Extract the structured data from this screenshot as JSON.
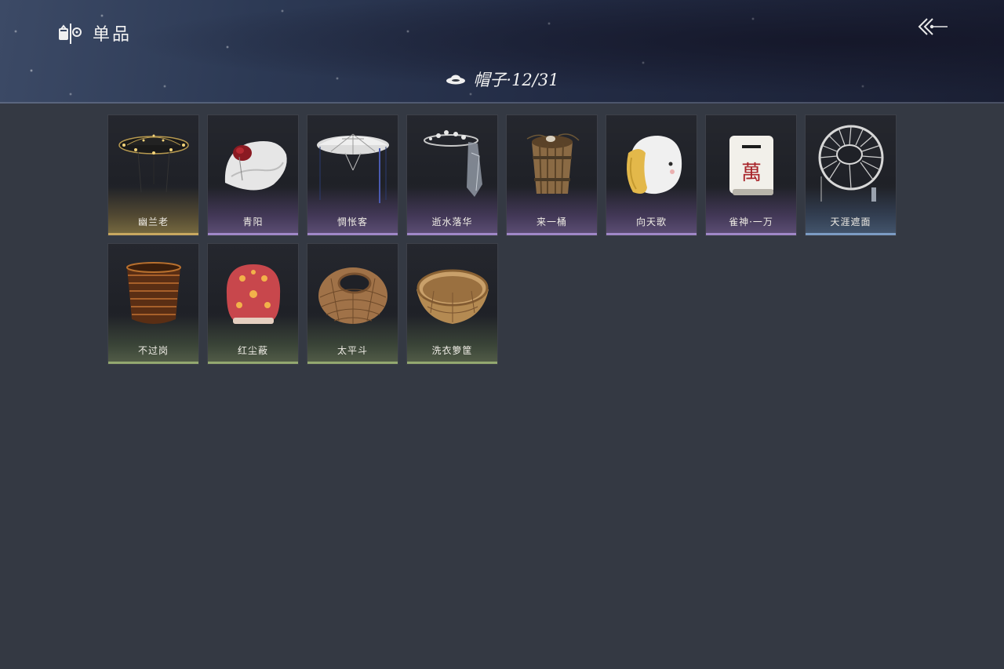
{
  "header": {
    "title": "单品",
    "category_label": "帽子·12/31"
  },
  "items": [
    {
      "name": "幽兰老",
      "rarity": "gold",
      "icon": "black-rain-hat-with-beads"
    },
    {
      "name": "青阳",
      "rarity": "purple",
      "icon": "white-cap-red-flower"
    },
    {
      "name": "惆怅客",
      "rarity": "purple",
      "icon": "white-conical-hat-veil"
    },
    {
      "name": "逝水落华",
      "rarity": "purple",
      "icon": "silver-headpiece-scarf"
    },
    {
      "name": "来一桶",
      "rarity": "purple",
      "icon": "wooden-bucket"
    },
    {
      "name": "向天歌",
      "rarity": "purple",
      "icon": "goose-head-hat"
    },
    {
      "name": "雀神·一万",
      "rarity": "purple",
      "icon": "mahjong-tile"
    },
    {
      "name": "天涯遮面",
      "rarity": "blue",
      "icon": "spoked-frame-hat"
    },
    {
      "name": "不过岗",
      "rarity": "green",
      "icon": "stacked-bowls"
    },
    {
      "name": "红尘蔽",
      "rarity": "green",
      "icon": "red-floral-hood"
    },
    {
      "name": "太平斗",
      "rarity": "green",
      "icon": "woven-basket-hat"
    },
    {
      "name": "洗衣箩筐",
      "rarity": "green",
      "icon": "woven-laundry-basket"
    }
  ],
  "colors": {
    "background": "#343943",
    "gold": "#c8a860",
    "purple": "#a088c8",
    "blue": "#7c9cc4",
    "green": "#93a870"
  }
}
